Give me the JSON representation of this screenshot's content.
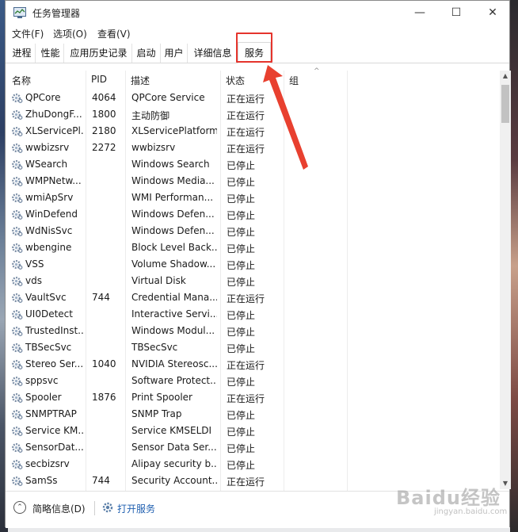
{
  "window": {
    "title": "任务管理器",
    "minimize": "—",
    "maximize": "☐",
    "close": "✕"
  },
  "menu": [
    "文件(F)",
    "选项(O)",
    "查看(V)"
  ],
  "tabs": [
    "进程",
    "性能",
    "应用历史记录",
    "启动",
    "用户",
    "详细信息",
    "服务"
  ],
  "active_tab": "服务",
  "columns": {
    "name": "名称",
    "pid": "PID",
    "desc": "描述",
    "status": "状态",
    "group": "组"
  },
  "rows": [
    {
      "name": "QPCore",
      "pid": "4064",
      "desc": "QPCore Service",
      "status": "正在运行"
    },
    {
      "name": "ZhuDongF...",
      "pid": "1800",
      "desc": "主动防御",
      "status": "正在运行"
    },
    {
      "name": "XLServicePl...",
      "pid": "2180",
      "desc": "XLServicePlatform",
      "status": "正在运行"
    },
    {
      "name": "wwbizsrv",
      "pid": "2272",
      "desc": "wwbizsrv",
      "status": "正在运行"
    },
    {
      "name": "WSearch",
      "pid": "",
      "desc": "Windows Search",
      "status": "已停止"
    },
    {
      "name": "WMPNetw...",
      "pid": "",
      "desc": "Windows Media...",
      "status": "已停止"
    },
    {
      "name": "wmiApSrv",
      "pid": "",
      "desc": "WMI Performan...",
      "status": "已停止"
    },
    {
      "name": "WinDefend",
      "pid": "",
      "desc": "Windows Defen...",
      "status": "已停止"
    },
    {
      "name": "WdNisSvc",
      "pid": "",
      "desc": "Windows Defen...",
      "status": "已停止"
    },
    {
      "name": "wbengine",
      "pid": "",
      "desc": "Block Level Back...",
      "status": "已停止"
    },
    {
      "name": "VSS",
      "pid": "",
      "desc": "Volume Shadow...",
      "status": "已停止"
    },
    {
      "name": "vds",
      "pid": "",
      "desc": "Virtual Disk",
      "status": "已停止"
    },
    {
      "name": "VaultSvc",
      "pid": "744",
      "desc": "Credential Mana...",
      "status": "正在运行"
    },
    {
      "name": "UI0Detect",
      "pid": "",
      "desc": "Interactive Servi...",
      "status": "已停止"
    },
    {
      "name": "TrustedInst...",
      "pid": "",
      "desc": "Windows Modul...",
      "status": "已停止"
    },
    {
      "name": "TBSecSvc",
      "pid": "",
      "desc": "TBSecSvc",
      "status": "已停止"
    },
    {
      "name": "Stereo Ser...",
      "pid": "1040",
      "desc": "NVIDIA Stereosc...",
      "status": "正在运行"
    },
    {
      "name": "sppsvc",
      "pid": "",
      "desc": "Software Protect...",
      "status": "已停止"
    },
    {
      "name": "Spooler",
      "pid": "1876",
      "desc": "Print Spooler",
      "status": "正在运行"
    },
    {
      "name": "SNMPTRAP",
      "pid": "",
      "desc": "SNMP Trap",
      "status": "已停止"
    },
    {
      "name": "Service KM...",
      "pid": "",
      "desc": "Service KMSELDI",
      "status": "已停止"
    },
    {
      "name": "SensorDat...",
      "pid": "",
      "desc": "Sensor Data Ser...",
      "status": "已停止"
    },
    {
      "name": "secbizsrv",
      "pid": "",
      "desc": "Alipay security b...",
      "status": "已停止"
    },
    {
      "name": "SamSs",
      "pid": "744",
      "desc": "Security Account...",
      "status": "正在运行"
    }
  ],
  "footer": {
    "fewer_details": "简略信息(D)",
    "open_services": "打开服务"
  },
  "colors": {
    "highlight": "#e5342c",
    "link": "#1f5fb0"
  },
  "watermark": {
    "text": "Baidu经验",
    "sub": "jingyan.baidu.com"
  }
}
